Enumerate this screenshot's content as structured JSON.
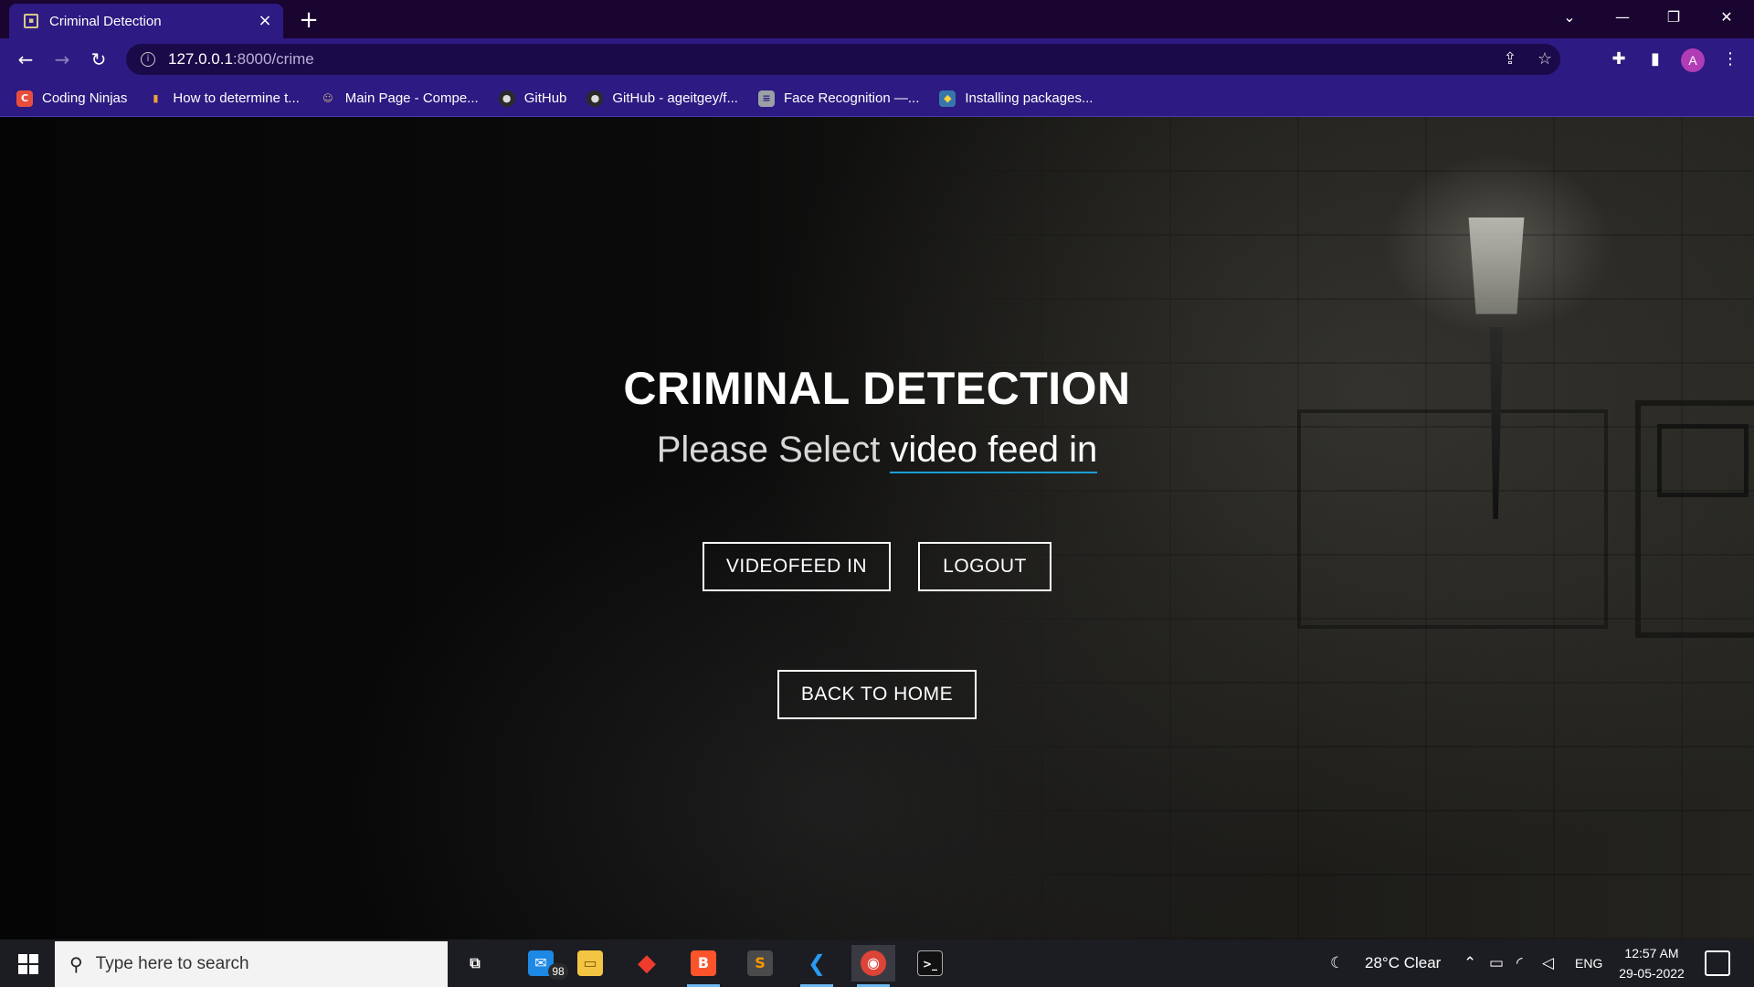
{
  "browser": {
    "tab_title": "Criminal Detection",
    "tab_close": "×",
    "new_tab": "+",
    "url_host": "127.0.0.1",
    "url_path": ":8000/crime",
    "bookmarks": [
      {
        "label": "Coding Ninjas",
        "icon": "coding-ninjas-icon",
        "color": "#e94e3d"
      },
      {
        "label": "How to determine t...",
        "icon": "analytics-icon",
        "color": "#f2a33a"
      },
      {
        "label": "Main Page - Compe...",
        "icon": "wiki-icon",
        "color": "#c9b48a"
      },
      {
        "label": "GitHub",
        "icon": "github-icon",
        "color": "#2a2a2a"
      },
      {
        "label": "GitHub - ageitgey/f...",
        "icon": "github-icon",
        "color": "#2a2a2a"
      },
      {
        "label": "Face Recognition —...",
        "icon": "doc-icon",
        "color": "#9aa0a6"
      },
      {
        "label": "Installing packages...",
        "icon": "python-icon",
        "color": "#3776ab"
      }
    ],
    "profile_initial": "A"
  },
  "page": {
    "title": "CRIMINAL DETECTION",
    "subtitle_prefix": "Please Select ",
    "subtitle_typed": "video feed in",
    "buttons": {
      "videofeed": "VIDEOFEED IN",
      "logout": "LOGOUT",
      "home": "BACK TO HOME"
    }
  },
  "taskbar": {
    "search_placeholder": "Type here to search",
    "mail_badge": "98",
    "weather": "28°C  Clear",
    "language": "ENG",
    "time": "12:57 AM",
    "date": "29-05-2022"
  },
  "colors": {
    "chrome_bg": "#2d1a82",
    "tabstrip_bg": "#1a0530",
    "typed_underline": "#1a9fd6"
  }
}
